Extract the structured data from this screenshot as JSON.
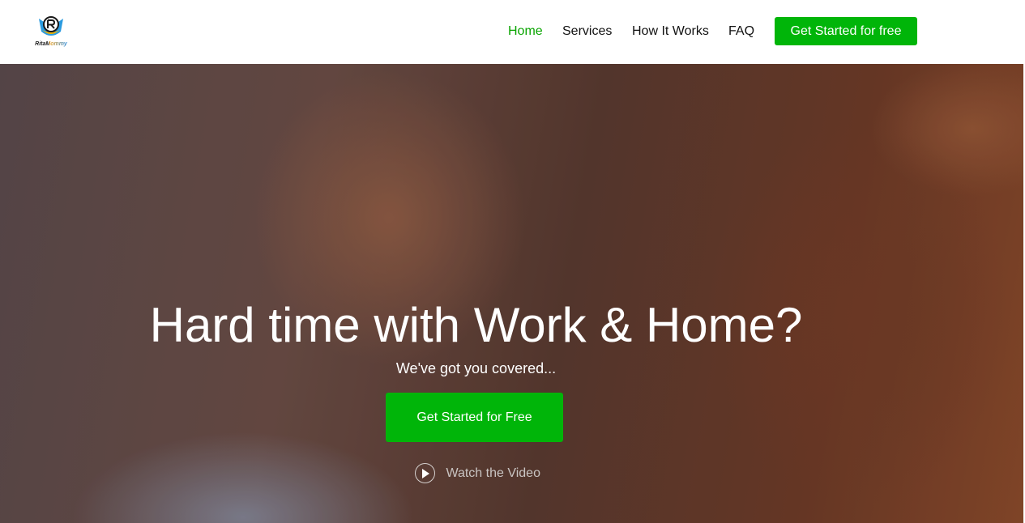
{
  "header": {
    "logo_icon": "r-shield-logo-icon",
    "logo_text": "RitaMommy",
    "nav": {
      "home": "Home",
      "services": "Services",
      "how_it_works": "How It Works",
      "faq": "FAQ",
      "cta": "Get Started for free"
    }
  },
  "hero": {
    "title": "Hard time with Work & Home?",
    "subtitle": "We've got you covered...",
    "cta": "Get Started for Free",
    "video_icon": "play-circle-icon",
    "video_label": "Watch the Video"
  },
  "colors": {
    "accent_green": "#00b509",
    "active_nav": "#09a400",
    "text_dark": "#111111",
    "white": "#ffffff"
  }
}
